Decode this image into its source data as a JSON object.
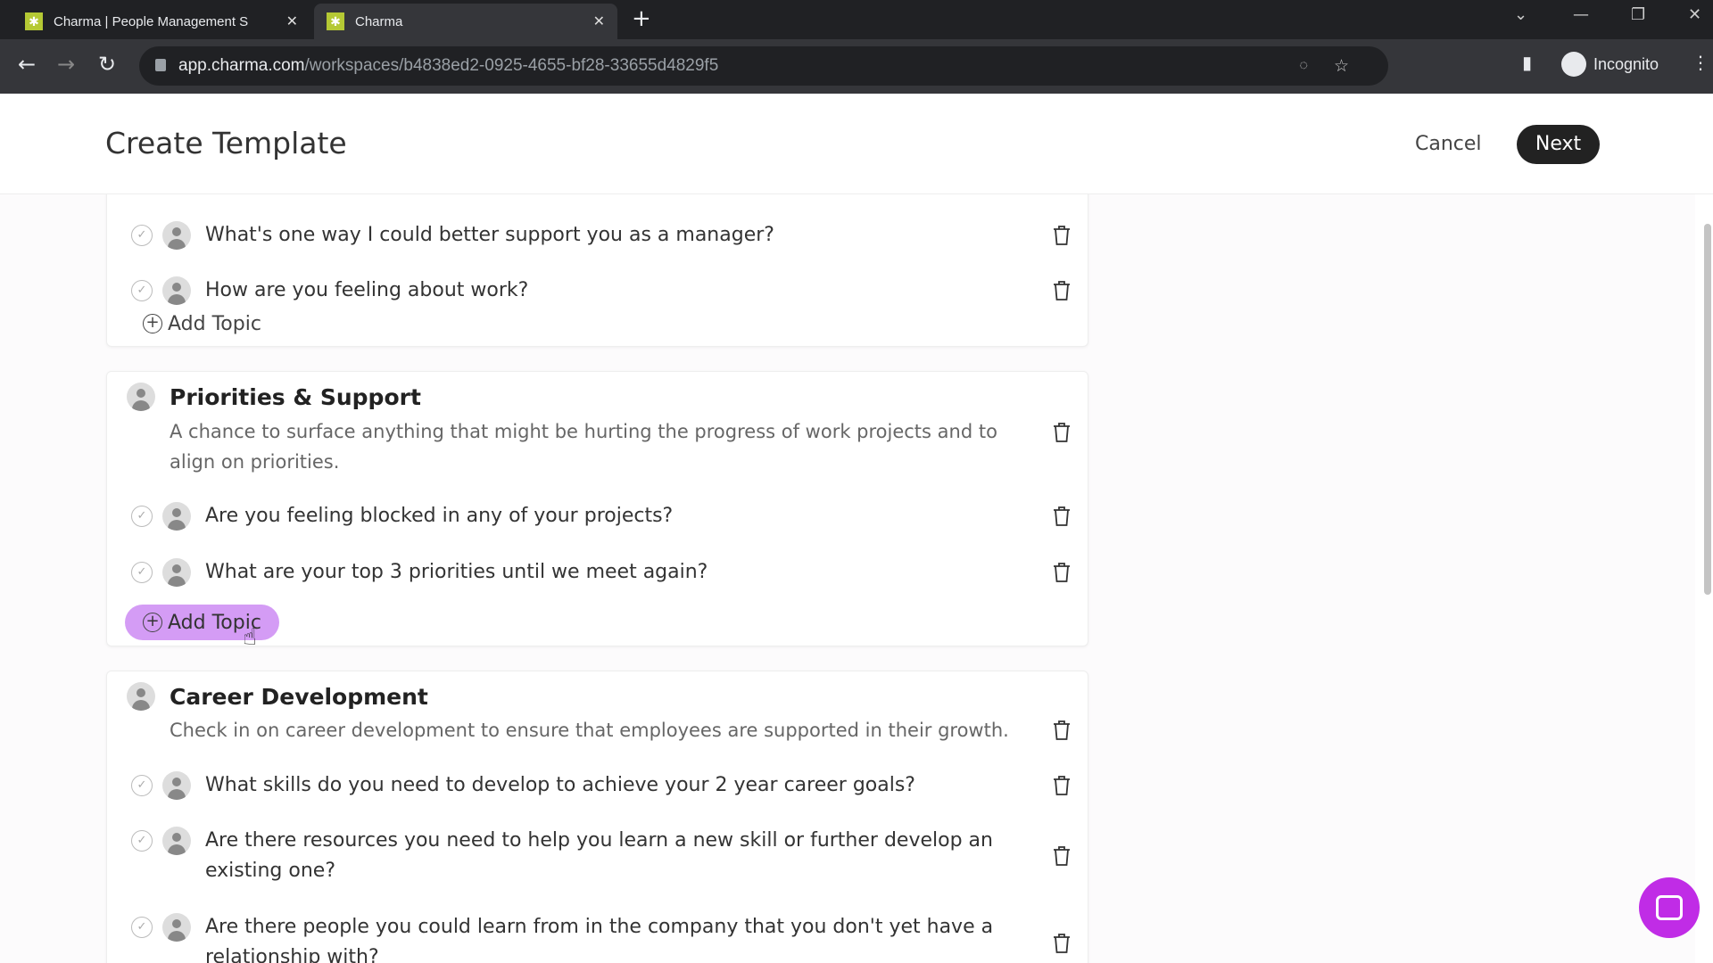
{
  "browser": {
    "tabs": [
      {
        "label": "Charma | People Management S",
        "active": false
      },
      {
        "label": "Charma",
        "active": true
      }
    ],
    "url_host": "app.charma.com",
    "url_path": "/workspaces/b4838ed2-0925-4655-bf28-33655d4829f5",
    "profile": "Incognito"
  },
  "header": {
    "title": "Create Template",
    "cancel": "Cancel",
    "next": "Next"
  },
  "sections": [
    {
      "title": "",
      "description": "",
      "topics": [
        "What's one way I could better support you as a manager?",
        "How are you feeling about work?"
      ],
      "add_topic": "Add Topic"
    },
    {
      "title": "Priorities & Support",
      "description": "A chance to surface anything that might be hurting the progress of work projects and to align on priorities.",
      "topics": [
        "Are you feeling blocked in any of your projects?",
        "What are your top 3 priorities until we meet again?"
      ],
      "add_topic": "Add Topic"
    },
    {
      "title": "Career Development",
      "description": "Check in on career development to ensure that employees are supported in their growth.",
      "topics": [
        "What skills do you need to develop to achieve your 2 year career goals?",
        "Are there resources you need to help you learn a new skill or further develop an existing one?",
        "Are there people you could learn from in the company that you don't yet have a relationship with?"
      ]
    }
  ],
  "colors": {
    "add_topic_highlight": "#d49cf5",
    "chat_bubble": "#c02ce6",
    "next_button": "#222222"
  }
}
